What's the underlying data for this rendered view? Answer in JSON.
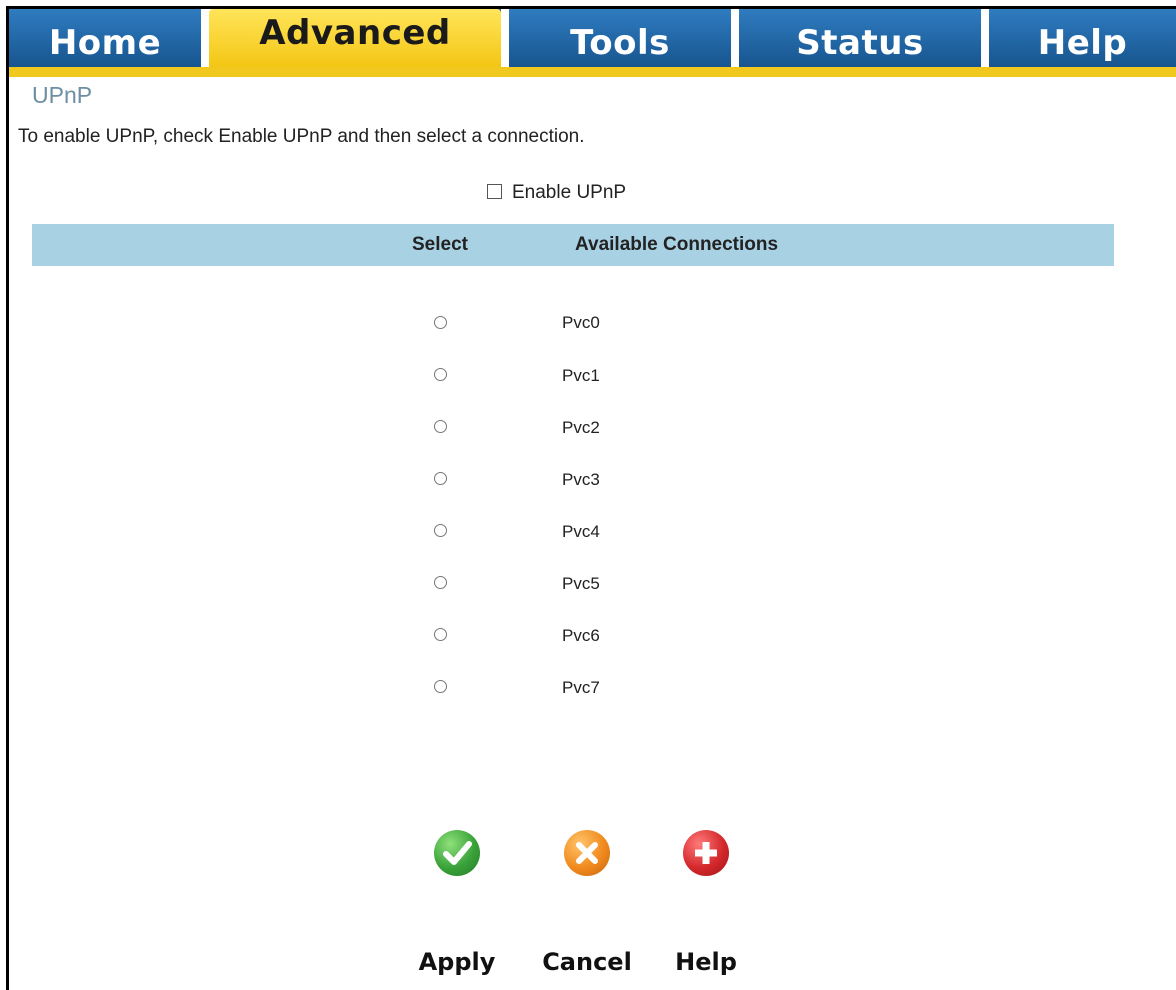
{
  "nav": {
    "tabs": [
      {
        "label": "Home",
        "active": false
      },
      {
        "label": "Advanced",
        "active": true
      },
      {
        "label": "Tools",
        "active": false
      },
      {
        "label": "Status",
        "active": false
      },
      {
        "label": "Help",
        "active": false
      }
    ]
  },
  "page": {
    "title": "UPnP",
    "intro": "To enable UPnP, check Enable UPnP and then select a connection.",
    "enable_label": "Enable UPnP",
    "enable_checked": false
  },
  "table": {
    "headers": {
      "select": "Select",
      "connections": "Available Connections"
    },
    "rows": [
      {
        "label": "Pvc0",
        "selected": false
      },
      {
        "label": "Pvc1",
        "selected": false
      },
      {
        "label": "Pvc2",
        "selected": false
      },
      {
        "label": "Pvc3",
        "selected": false
      },
      {
        "label": "Pvc4",
        "selected": false
      },
      {
        "label": "Pvc5",
        "selected": false
      },
      {
        "label": "Pvc6",
        "selected": false
      },
      {
        "label": "Pvc7",
        "selected": false
      }
    ]
  },
  "buttons": {
    "apply": {
      "label": "Apply",
      "icon": "check-icon",
      "color": "#3aa23a"
    },
    "cancel": {
      "label": "Cancel",
      "icon": "x-icon",
      "color": "#f08a1e"
    },
    "help": {
      "label": "Help",
      "icon": "plus-icon",
      "color": "#d4282c"
    }
  },
  "colors": {
    "tab_blue": "#1f63a0",
    "tab_active": "#f4c614",
    "header_row": "#a9d1e4",
    "title": "#6c8fa3"
  }
}
